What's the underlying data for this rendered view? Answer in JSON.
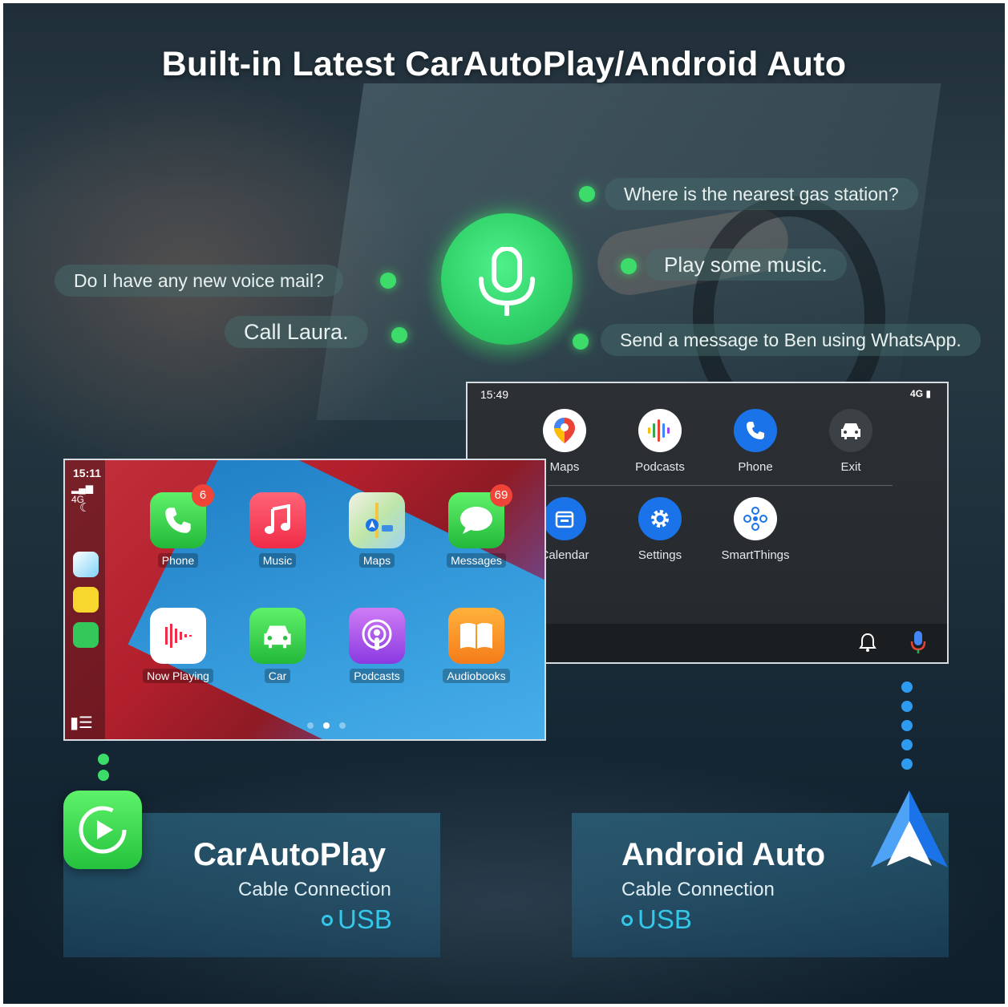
{
  "headline": "Built-in Latest CarAutoPlay/Android Auto",
  "voice_commands": {
    "left": [
      "Do I have any new voice mail?",
      "Call Laura."
    ],
    "right": [
      "Where is the nearest gas station?",
      "Play some music.",
      "Send a message to Ben using WhatsApp."
    ]
  },
  "android_auto_screen": {
    "time": "15:49",
    "signal": "4G",
    "apps_row1": [
      "Maps",
      "Podcasts",
      "Phone",
      "Exit"
    ],
    "apps_row2": [
      "Calendar",
      "Settings",
      "SmartThings"
    ]
  },
  "carplay_screen": {
    "time": "15:11",
    "network": "4G",
    "apps_row1": [
      {
        "label": "Phone",
        "badge": "6"
      },
      {
        "label": "Music",
        "badge": ""
      },
      {
        "label": "Maps",
        "badge": ""
      },
      {
        "label": "Messages",
        "badge": "69"
      }
    ],
    "apps_row2": [
      {
        "label": "Now Playing"
      },
      {
        "label": "Car"
      },
      {
        "label": "Podcasts"
      },
      {
        "label": "Audiobooks"
      }
    ]
  },
  "panels": {
    "carplay": {
      "title": "CarAutoPlay",
      "subtitle": "Cable Connection",
      "connection": "USB"
    },
    "android": {
      "title": "Android Auto",
      "subtitle": "Cable Connection",
      "connection": "USB"
    }
  },
  "colors": {
    "accent_green": "#3ddc6a",
    "usb_cyan": "#34c7e8",
    "android_blue": "#2196f3"
  }
}
